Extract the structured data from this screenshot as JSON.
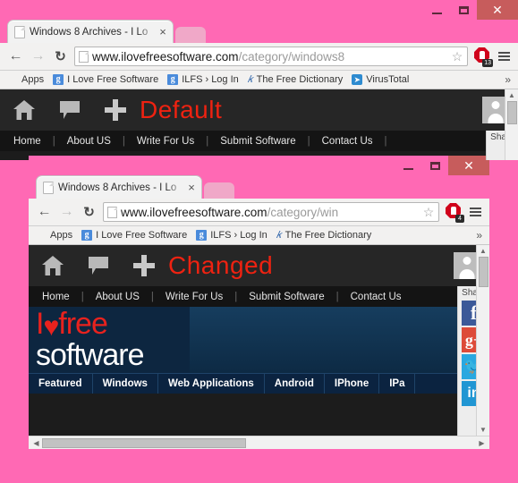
{
  "desktop": {
    "background_color": "#ff69b4"
  },
  "window_back": {
    "controls": {
      "minimize": "–",
      "maximize": "□",
      "close": "✕"
    },
    "tab": {
      "title": "Windows 8 Archives - I Lo",
      "close_label": "×",
      "favicon": "page-icon"
    },
    "toolbar": {
      "back": "←",
      "forward": "→",
      "reload": "↻",
      "url_host": "www.ilovefreesoftware.com",
      "url_path": "/category/windows8",
      "star": "☆",
      "extension_badge": "13",
      "menu": "menu-icon"
    },
    "bookmarks": [
      {
        "label": "Apps",
        "icon": "apps-grid-icon"
      },
      {
        "label": "I Love Free Software",
        "icon": "google-icon"
      },
      {
        "label": "ILFS › Log In",
        "icon": "google-icon"
      },
      {
        "label": "The Free Dictionary",
        "icon": "dictionary-icon"
      },
      {
        "label": "VirusTotal",
        "icon": "virustotal-icon"
      }
    ],
    "bookmarks_overflow": "»",
    "page": {
      "overlay_label": "Default",
      "overlay_color": "#ee2211",
      "topbar_icons": [
        "home-icon",
        "comment-icon",
        "plus-icon"
      ],
      "avatar": "user-avatar",
      "nav_items": [
        "Home",
        "About US",
        "Write For Us",
        "Submit Software",
        "Contact Us"
      ],
      "share_label": "Share"
    }
  },
  "window_front": {
    "controls": {
      "minimize": "–",
      "maximize": "□",
      "close": "✕"
    },
    "tab": {
      "title": "Windows 8 Archives - I Lo",
      "close_label": "×",
      "favicon": "page-icon"
    },
    "toolbar": {
      "back": "←",
      "forward": "→",
      "reload": "↻",
      "url_host": "www.ilovefreesoftware.com",
      "url_path": "/category/win",
      "star": "☆",
      "extension_badge": "4",
      "menu": "menu-icon"
    },
    "bookmarks": [
      {
        "label": "Apps",
        "icon": "apps-grid-icon"
      },
      {
        "label": "I Love Free Software",
        "icon": "google-icon"
      },
      {
        "label": "ILFS › Log In",
        "icon": "google-icon"
      },
      {
        "label": "The Free Dictionary",
        "icon": "dictionary-icon"
      }
    ],
    "bookmarks_overflow": "»",
    "page": {
      "overlay_label": "Changed",
      "overlay_color": "#ee2211",
      "topbar_icons": [
        "home-icon",
        "comment-icon",
        "plus-icon"
      ],
      "avatar": "user-avatar",
      "nav_items": [
        "Home",
        "About US",
        "Write For Us",
        "Submit Software",
        "Contact Us"
      ],
      "logo_line1": "free",
      "logo_line2": "software",
      "logo_heart": "♥",
      "logo_i": "I",
      "categories": [
        "Featured",
        "Windows",
        "Web Applications",
        "Android",
        "IPhone",
        "IPa"
      ],
      "share_label": "Share",
      "share_buttons": [
        "facebook",
        "google-plus",
        "twitter",
        "linkedin"
      ],
      "scroll_down_caret": "▼",
      "hscroll_left": "◀",
      "hscroll_right": "▶",
      "vscroll_up": "▲",
      "vscroll_down": "▼"
    }
  }
}
